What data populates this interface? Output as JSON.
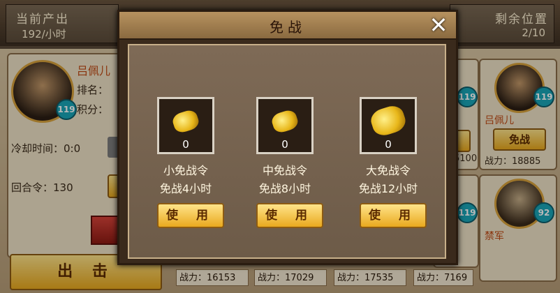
{
  "header": {
    "output_label": "当前产出",
    "output_value": "192/小时",
    "remaining_label": "剩余位置",
    "remaining_value": "2/10"
  },
  "player": {
    "name": "吕佩儿",
    "level": "119",
    "rank_label": "排名：",
    "score_label": "积分：",
    "cooldown": "冷却时间：0:0",
    "rounds": "回合令：130"
  },
  "attack_button": "出 击",
  "right_cards": [
    {
      "name": "吕佩儿",
      "level": "119",
      "button": "免战",
      "power": "战力：18885"
    },
    {
      "name": "禁军",
      "level": "92"
    }
  ],
  "mid_levels": [
    "119",
    "119"
  ],
  "partial_power": "5100",
  "power_bar": [
    "战力：16153",
    "战力：17029",
    "战力：17535",
    "战力：7169"
  ],
  "modal": {
    "title": "免战",
    "items": [
      {
        "name": "小免战令",
        "desc": "免战4小时",
        "count": "0",
        "button": "使 用"
      },
      {
        "name": "中免战令",
        "desc": "免战8小时",
        "count": "0",
        "button": "使 用"
      },
      {
        "name": "大免战令",
        "desc": "免战12小时",
        "count": "0",
        "button": "使 用"
      }
    ]
  },
  "colors": {
    "accent_gold": "#e9a91e",
    "level_badge": "#1aa6b8",
    "name_red": "#c04a14"
  }
}
